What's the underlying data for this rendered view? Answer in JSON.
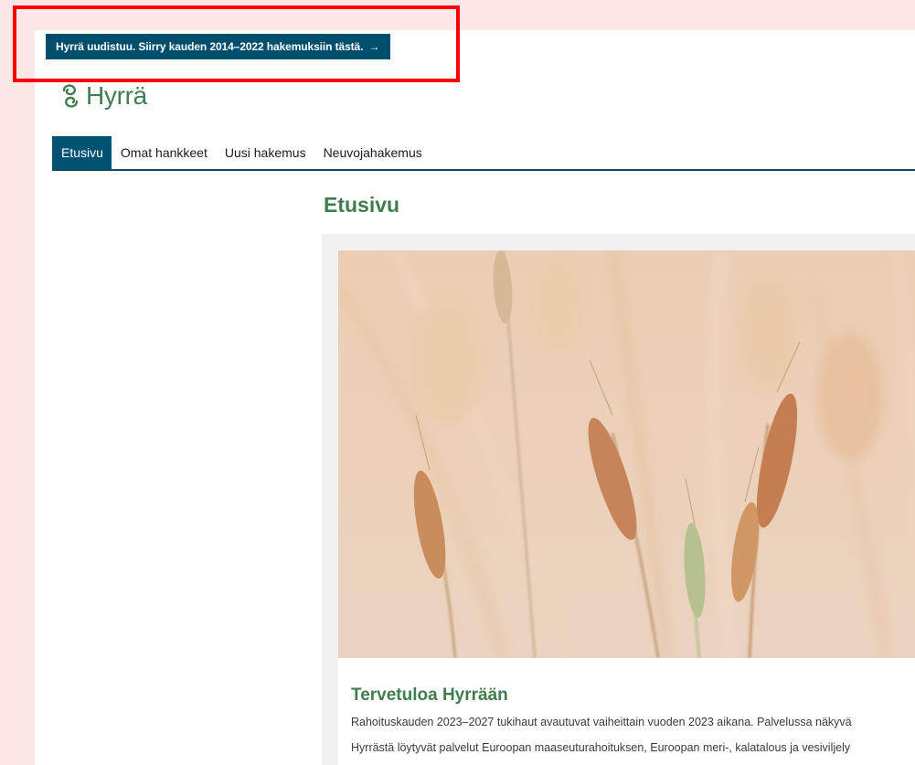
{
  "banner": {
    "text": "Hyrrä uudistuu. Siirry kauden 2014–2022 hakemuksiin tästä.",
    "arrow": "→"
  },
  "logo": {
    "text": "Hyrrä"
  },
  "nav": {
    "items": [
      {
        "label": "Etusivu",
        "active": true
      },
      {
        "label": "Omat hankkeet"
      },
      {
        "label": "Uusi hakemus"
      },
      {
        "label": "Neuvojahakemus"
      }
    ]
  },
  "main": {
    "title": "Etusivu",
    "card": {
      "image_alt": "wheat-field-image",
      "title": "Tervetuloa Hyrrään",
      "paragraphs": [
        "Rahoituskauden 2023–2027 tukihaut avautuvat vaiheittain vuoden 2023 aikana. Palvelussa näkyvä",
        "Hyrrästä löytyvät palvelut Euroopan maaseuturahoituksen, Euroopan meri-, kalatalous ja vesiviljely"
      ]
    }
  },
  "colors": {
    "background": "#fde7e6",
    "banner": "#004e6e",
    "nav_active": "#005273",
    "brand_green": "#3f7d4e",
    "highlight": "#ff0000"
  }
}
